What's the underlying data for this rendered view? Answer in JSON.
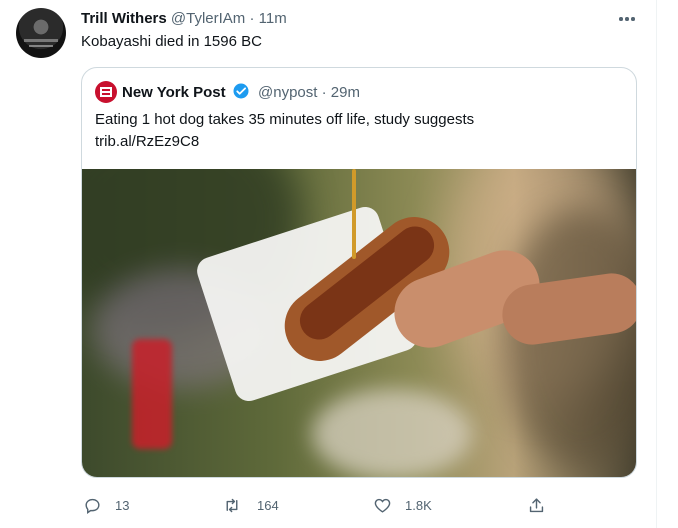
{
  "tweet": {
    "display_name": "Trill Withers",
    "handle": "@TylerIAm",
    "separator": "·",
    "time": "11m",
    "text": "Kobayashi died in 1596 BC"
  },
  "quoted_tweet": {
    "display_name": "New York Post",
    "handle": "@nypost",
    "separator": "·",
    "time": "29m",
    "text": "Eating 1 hot dog takes 35 minutes off life, study suggests",
    "link": "trib.al/RzEz9C8"
  },
  "actions": {
    "reply_count": "13",
    "retweet_count": "164",
    "like_count": "1.8K"
  },
  "icons": {
    "more": "more-options-icon",
    "verified": "verified-badge-icon",
    "reply": "reply-icon",
    "retweet": "retweet-icon",
    "like": "like-icon",
    "share": "share-icon"
  },
  "colors": {
    "accent": "#1d9bf0",
    "muted_text": "#536471",
    "border": "#cfd9de",
    "nypost_red": "#c8102e"
  }
}
